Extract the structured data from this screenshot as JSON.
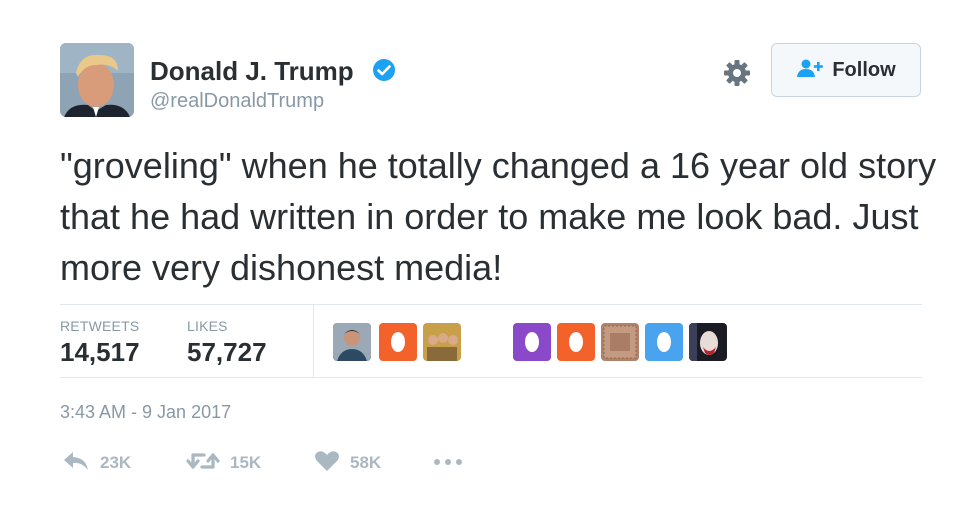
{
  "tweet": {
    "author_name": "Donald J. Trump",
    "author_handle": "@realDonaldTrump",
    "follow_label": "Follow",
    "text": "\"groveling\" when he totally changed a 16 year old story that he had written in order to make me look bad. Just more very dishonest media!",
    "timestamp": "3:43 AM - 9 Jan 2017"
  },
  "stats": {
    "retweets_label": "RETWEETS",
    "retweets_value": "14,517",
    "likes_label": "LIKES",
    "likes_value": "57,727"
  },
  "likers": [
    {
      "icon": "profile-photo",
      "color": "#7a8a99"
    },
    {
      "icon": "egg-avatar",
      "color": "#f4622c"
    },
    {
      "icon": "profile-photo",
      "color": "#c8a04a"
    },
    {
      "icon": "egg-avatar",
      "color": "#8a49c9"
    },
    {
      "icon": "egg-avatar",
      "color": "#f4622c"
    },
    {
      "icon": "profile-photo",
      "color": "#b0826a"
    },
    {
      "icon": "egg-avatar",
      "color": "#4aa3ef"
    },
    {
      "icon": "profile-photo",
      "color": "#2b2b3a"
    }
  ],
  "actions": {
    "reply_count": "23K",
    "retweet_count": "15K",
    "like_count": "58K"
  },
  "colors": {
    "verified_blue": "#1da1f2",
    "secondary_text": "#8899a6",
    "action_gray": "#aab8c2"
  }
}
